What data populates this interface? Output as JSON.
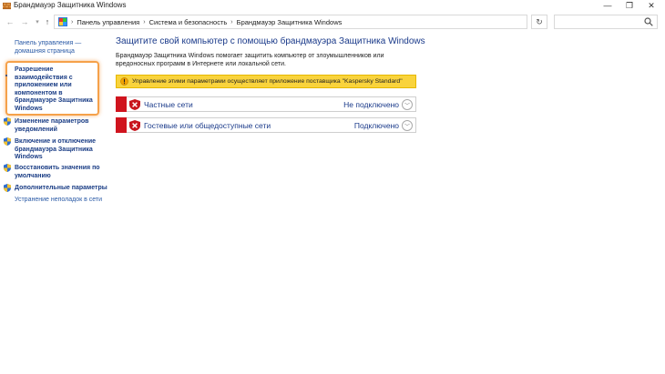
{
  "window": {
    "title": "Брандмауэр Защитника Windows",
    "minimize": "—",
    "maximize": "❐",
    "close": "✕"
  },
  "address": {
    "breadcrumbs": [
      "Панель управления",
      "Система и безопасность",
      "Брандмауэр Защитника Windows"
    ],
    "back": "←",
    "forward": "→",
    "recent": "▾",
    "up": "↑",
    "refresh": "↻",
    "search_placeholder": ""
  },
  "sidebar": {
    "home": [
      "Панель управления —",
      "домашняя страница"
    ],
    "allow_app": [
      "Разрешение",
      "взаимодействия с",
      "приложением или",
      "компонентом в",
      "брандмауэре Защитника",
      "Windows"
    ],
    "notifications": [
      "Изменение параметров",
      "уведомлений"
    ],
    "toggle": [
      "Включение и отключение",
      "брандмауэра Защитника",
      "Windows"
    ],
    "restore": [
      "Восстановить значения по",
      "умолчанию"
    ],
    "advanced": "Дополнительные параметры",
    "troubleshoot": "Устранение неполадок в сети"
  },
  "main": {
    "title": "Защитите свой компьютер с помощью брандмауэра Защитника Windows",
    "description": [
      "Брандмауэр Защитника Windows помогает защитить компьютер от злоумышленников или",
      "вредоносных программ в Интернете или локальной сети."
    ],
    "warning": "Управление этими параметрами осуществляет приложение поставщика \"Kaspersky Standard\"",
    "networks": [
      {
        "name": "Частные сети",
        "status": "Не подключено"
      },
      {
        "name": "Гостевые или общедоступные сети",
        "status": "Подключено"
      }
    ]
  },
  "colors": {
    "accent": "#1a3a8a",
    "warning": "#f9d33c",
    "danger": "#d0141e",
    "highlight": "#f5a14a"
  }
}
